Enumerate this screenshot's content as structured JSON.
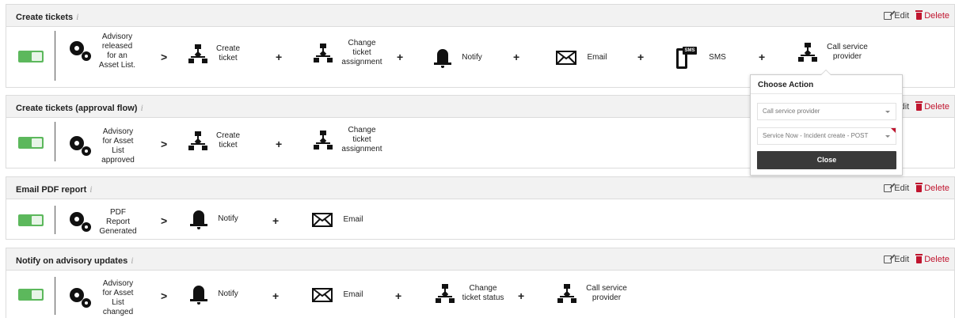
{
  "actions": {
    "edit": "Edit",
    "delete": "Delete"
  },
  "info": "i",
  "symbols": {
    "then": ">",
    "and": "+"
  },
  "rules": [
    {
      "title": "Create tickets",
      "trigger": "Advisory released for an Asset List.",
      "steps": [
        "Create ticket",
        "Change ticket assignment",
        "Notify",
        "Email",
        "SMS",
        "Call service provider"
      ],
      "enabled": true
    },
    {
      "title": "Create tickets (approval flow)",
      "trigger": "Advisory for Asset List approved",
      "steps": [
        "Create ticket",
        "Change ticket assignment"
      ],
      "enabled": true
    },
    {
      "title": "Email PDF report",
      "trigger": "PDF Report Generated",
      "steps": [
        "Notify",
        "Email"
      ],
      "enabled": true
    },
    {
      "title": "Notify on advisory updates",
      "trigger": "Advisory for Asset List changed",
      "steps": [
        "Notify",
        "Email",
        "Change ticket status",
        "Call service provider"
      ],
      "enabled": true
    }
  ],
  "popover": {
    "title": "Choose Action",
    "action_select": "Call service provider",
    "endpoint_select": "Service Now - Incident create - POST",
    "close_label": "Close"
  },
  "colors": {
    "toggle_on": "#5cb85c",
    "delete": "#c0152f",
    "close_button": "#3a3a3a"
  }
}
